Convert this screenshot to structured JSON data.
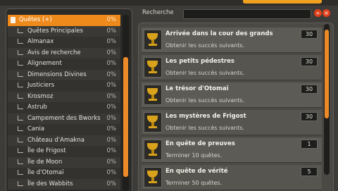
{
  "categories": {
    "items": [
      {
        "label": "Quêtes (+)",
        "percent": "0%",
        "selected": true
      },
      {
        "label": "Quêtes Principales",
        "percent": "0%"
      },
      {
        "label": "Almanax",
        "percent": "0%"
      },
      {
        "label": "Avis de recherche",
        "percent": "0%"
      },
      {
        "label": "Alignement",
        "percent": "0%"
      },
      {
        "label": "Dimensions Divines",
        "percent": "0%"
      },
      {
        "label": "Justiciers",
        "percent": "0%"
      },
      {
        "label": "Krosmoz",
        "percent": "0%"
      },
      {
        "label": "Astrub",
        "percent": "0%"
      },
      {
        "label": "Campement des Bworks",
        "percent": "0%"
      },
      {
        "label": "Cania",
        "percent": "0%"
      },
      {
        "label": "Château d'Amakna",
        "percent": "0%"
      },
      {
        "label": "Île de Frigost",
        "percent": "0%"
      },
      {
        "label": "Île de Moon",
        "percent": "0%"
      },
      {
        "label": "Île d'Otomaï",
        "percent": "0%"
      },
      {
        "label": "Île des Wabbits",
        "percent": "0%"
      }
    ]
  },
  "search": {
    "label": "Recherche",
    "value": "",
    "expand_symbol": "»",
    "close_symbol": "×"
  },
  "achievements": [
    {
      "title": "Arrivée dans la cour des grands",
      "description": "Obtenir les succès suivants.",
      "points": "30"
    },
    {
      "title": "Les petits pédestres",
      "description": "Obtenir les succès suivants.",
      "points": "30"
    },
    {
      "title": "Le trésor d'Otomaï",
      "description": "Obtenir les succès suivants.",
      "points": "30"
    },
    {
      "title": "Les mystères de Frigost",
      "description": "Obtenir les succès suivants.",
      "points": "30"
    },
    {
      "title": "En quête de preuves",
      "description": "Terminer 10 quêtes.",
      "points": "1"
    },
    {
      "title": "En quête de vérité",
      "description": "Terminer 50 quêtes.",
      "points": "5"
    }
  ],
  "colors": {
    "accent": "#ee8a1c",
    "panel": "#2a2a28",
    "close": "#e0401c"
  }
}
